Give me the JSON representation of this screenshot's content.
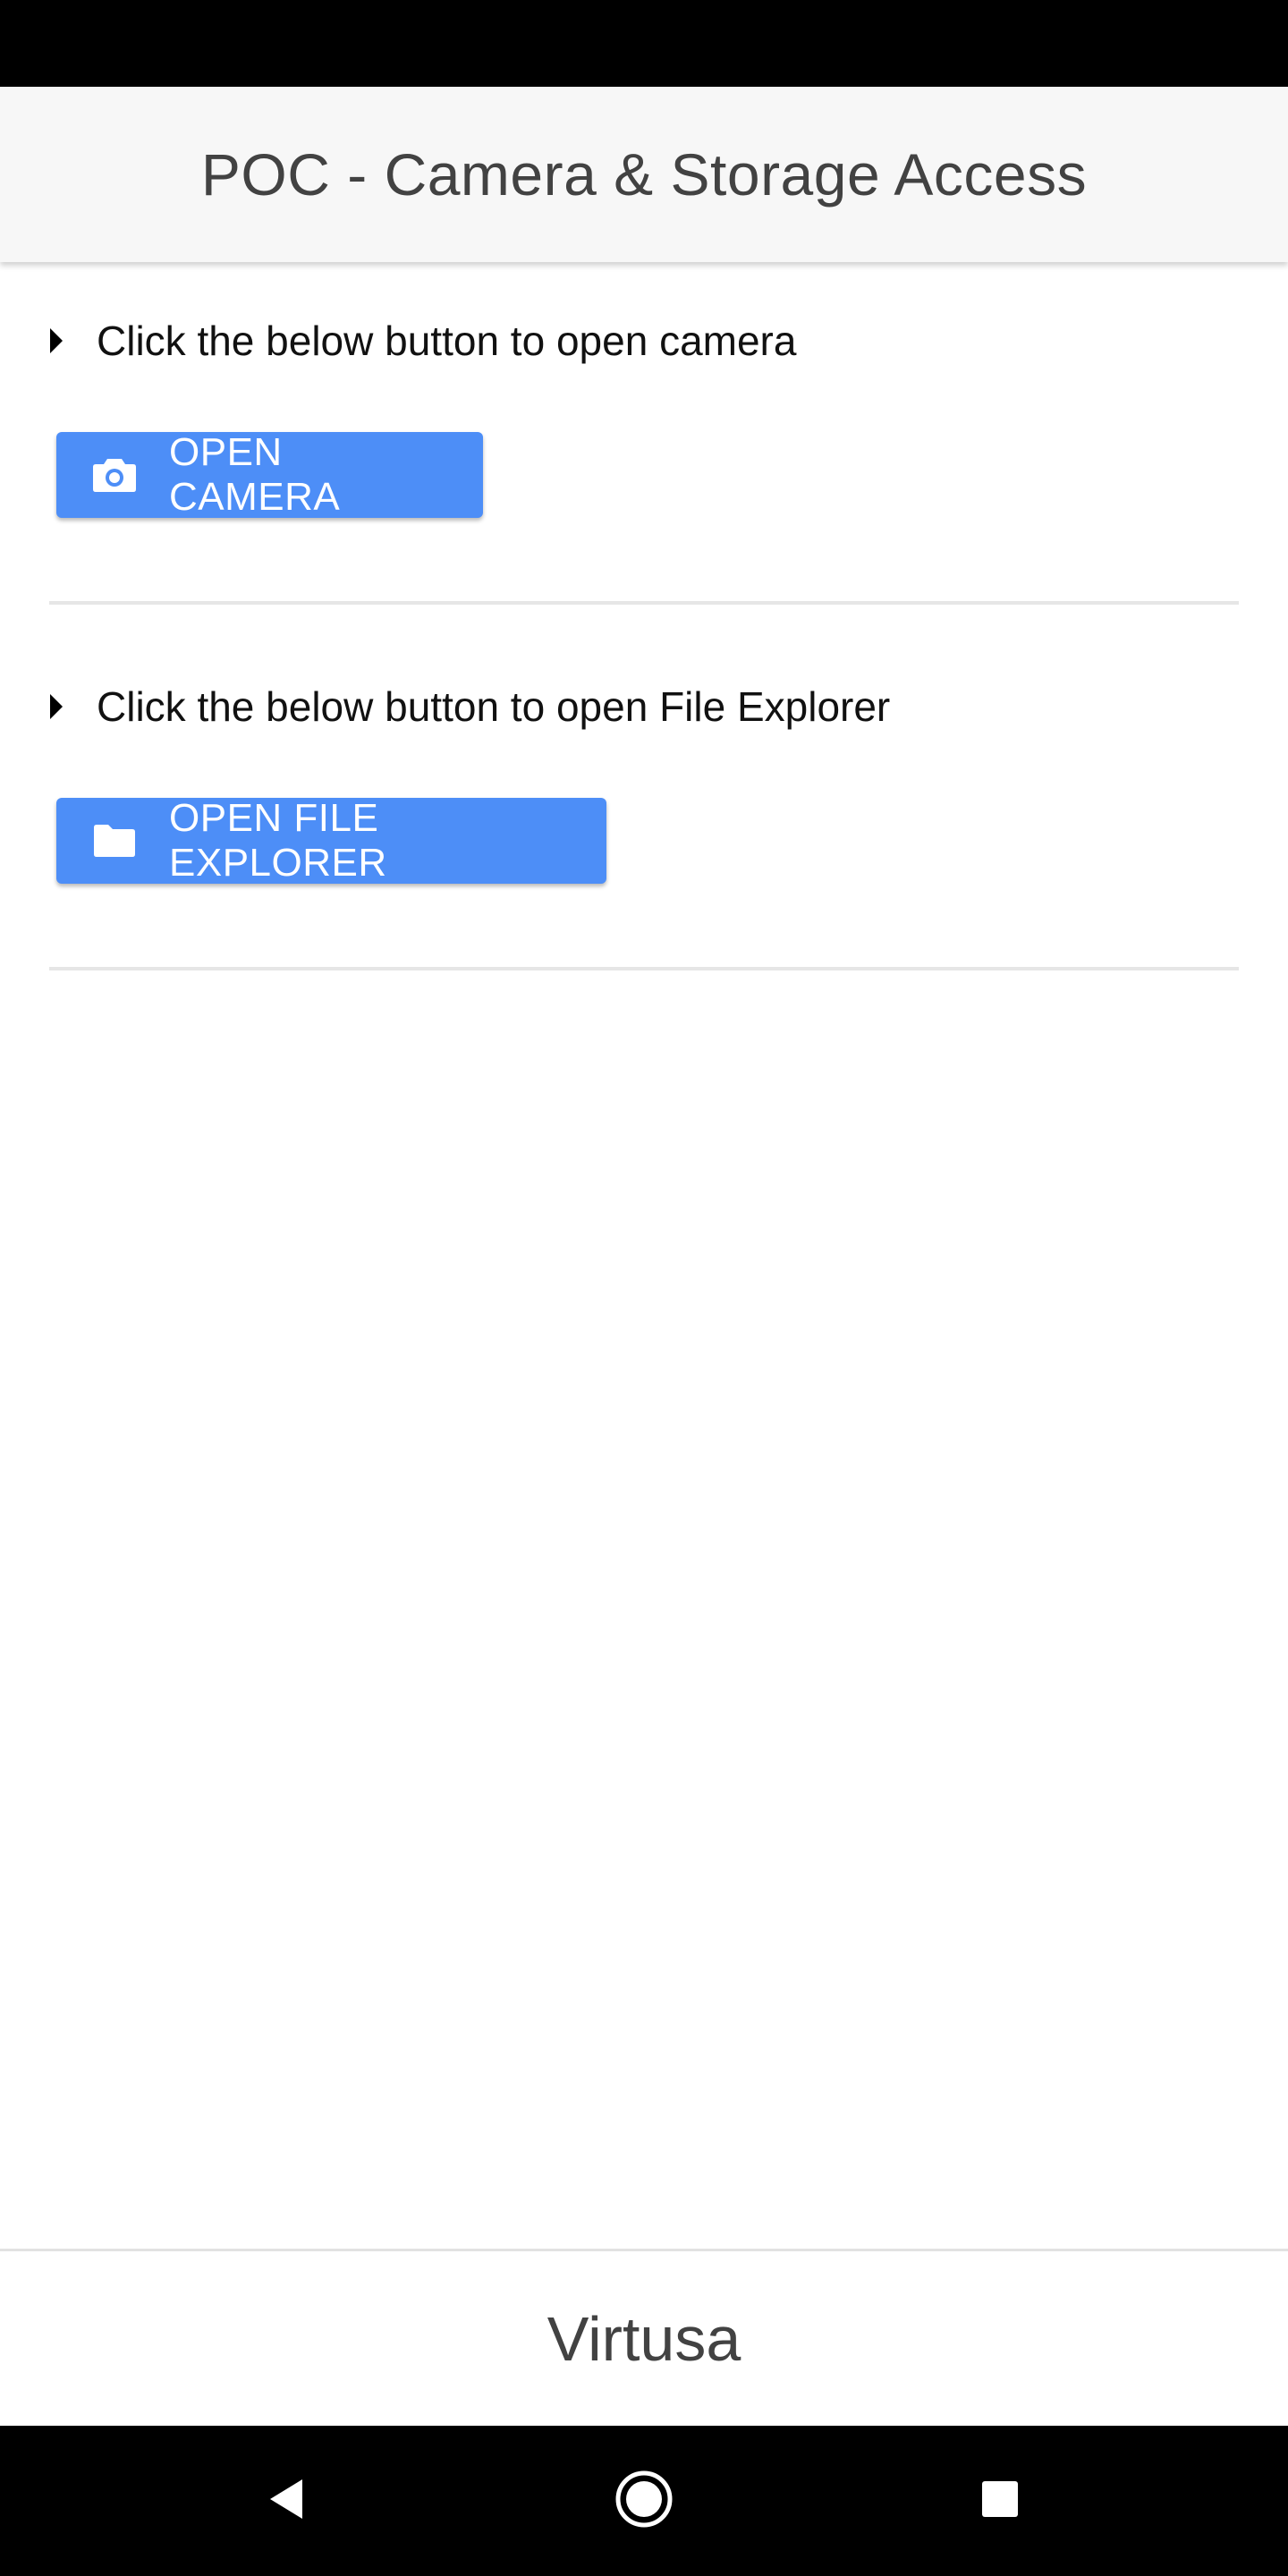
{
  "header": {
    "title": "POC - Camera & Storage Access"
  },
  "sections": [
    {
      "instruction": "Click the below button to open camera",
      "button_label": "OPEN CAMERA",
      "icon": "camera-icon"
    },
    {
      "instruction": "Click the below button to open File Explorer",
      "button_label": "OPEN FILE EXPLORER",
      "icon": "folder-icon"
    }
  ],
  "footer": {
    "text": "Virtusa"
  },
  "nav": {
    "back_icon": "back-triangle-icon",
    "home_icon": "home-circle-icon",
    "recents_icon": "recents-square-icon"
  },
  "colors": {
    "accent": "#4d8ef7",
    "header_bg": "#f7f7f7",
    "text_dark": "#424242"
  }
}
